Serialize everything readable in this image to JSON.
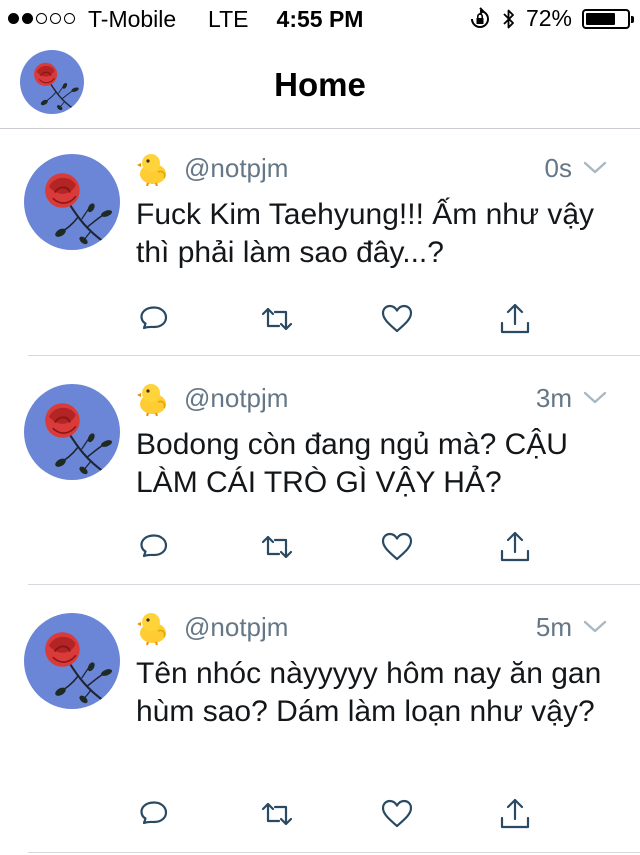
{
  "status_bar": {
    "carrier": "T-Mobile",
    "network": "LTE",
    "time": "4:55 PM",
    "battery_percent": "72%",
    "battery_level": 0.72,
    "signal_bars_filled": 2,
    "signal_bars_total": 5
  },
  "nav": {
    "title": "Home"
  },
  "tweets": [
    {
      "handle": "@notpjm",
      "time": "0s",
      "text": "Fuck Kim Taehyung!!! Ấm như vậy thì phải làm sao đây...?"
    },
    {
      "handle": "@notpjm",
      "time": "3m",
      "text": "Bodong còn đang ngủ mà? CẬU LÀM CÁI TRÒ GÌ VẬY HẢ?"
    },
    {
      "handle": "@notpjm",
      "time": "5m",
      "text": "Tên nhóc nàyyyyy hôm nay ăn gan hùm sao? Dám làm loạn như vậy?"
    }
  ],
  "colors": {
    "secondary_text": "#657786",
    "action_icon": "#2a4a63",
    "avatar_background": "#6b86d6",
    "rose": "#d93a3a"
  },
  "icons": [
    "rose-avatar",
    "chick-emoji",
    "caret-down-icon",
    "reply-icon",
    "retweet-icon",
    "like-icon",
    "share-icon",
    "orientation-lock-icon",
    "bluetooth-icon",
    "battery-icon"
  ]
}
